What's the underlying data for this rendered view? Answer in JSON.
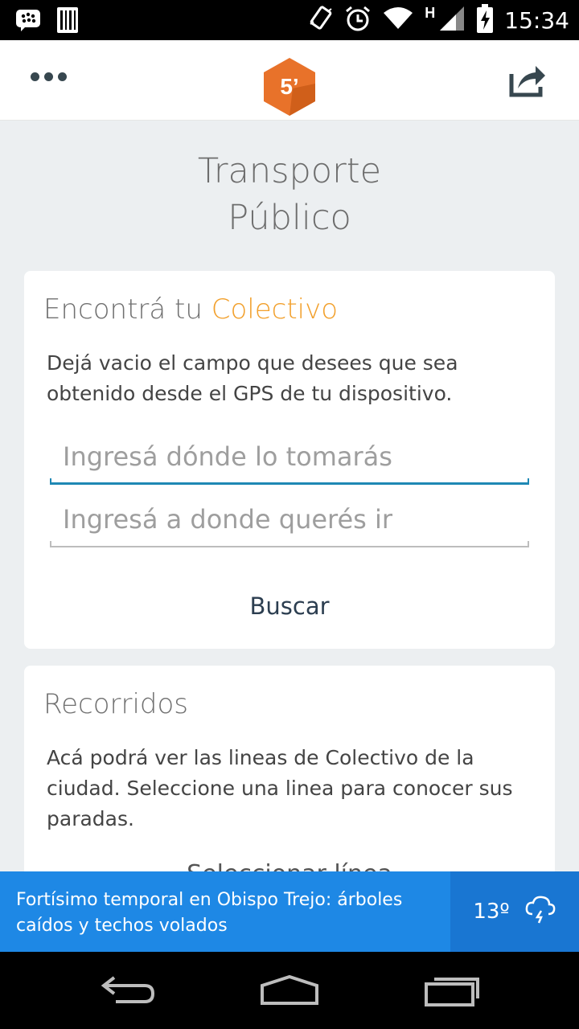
{
  "status_bar": {
    "time": "15:34",
    "network_type": "H",
    "icons": [
      "blackberry-messenger-icon",
      "barcode-icon",
      "vibrate-icon",
      "alarm-icon",
      "wifi-icon",
      "signal-icon",
      "battery-charging-icon"
    ]
  },
  "app_bar": {
    "logo_text": "5’",
    "menu_icon": "more-dots-icon",
    "share_icon": "share-icon",
    "colors": {
      "logo": "#e8722a",
      "logo_shadow": "#c95a17"
    }
  },
  "page": {
    "title_line1": "Transporte",
    "title_line2": "Público"
  },
  "search_card": {
    "heading_prefix": "Encontrá tu",
    "heading_accent": "Colectivo",
    "accent_color": "#f2a02c",
    "description": "Dejá vacio el campo que desees que sea obtenido desde el GPS de tu dispositivo.",
    "from_field": {
      "placeholder": "Ingresá dónde lo tomarás",
      "value": ""
    },
    "to_field": {
      "placeholder": "Ingresá a donde querés ir",
      "value": ""
    },
    "search_button": "Buscar"
  },
  "routes_card": {
    "heading": "Recorridos",
    "description": "Acá podrá ver las lineas de Colectivo de la ciudad. Seleccione una linea para conocer sus paradas.",
    "select_label": "Seleccionar línea"
  },
  "news_banner": {
    "headline": "Fortísimo temporal en Obispo Trejo: árboles caídos y techos volados",
    "temperature": "13º",
    "weather_icon": "storm-cloud-icon"
  },
  "nav_bar": {
    "buttons": [
      "back-icon",
      "home-icon",
      "recents-icon"
    ]
  }
}
